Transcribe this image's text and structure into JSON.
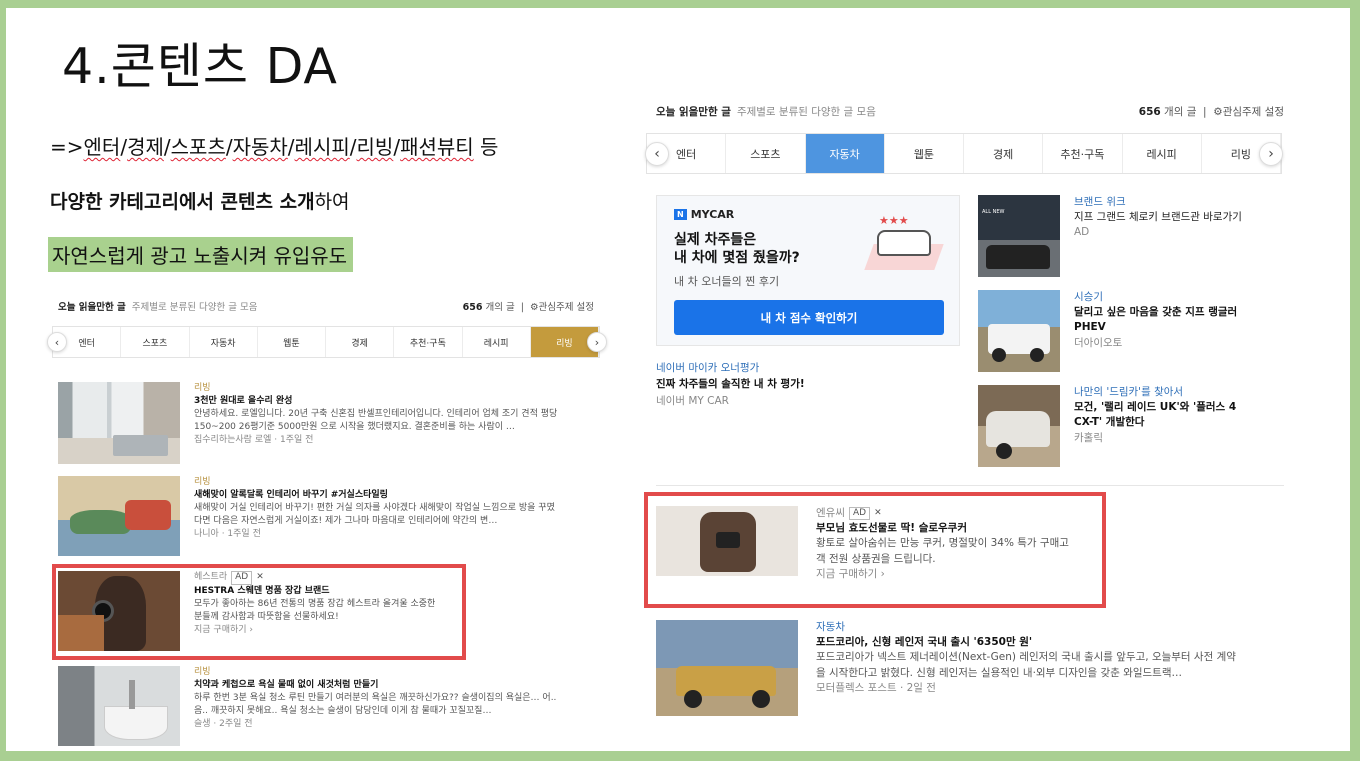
{
  "slide": {
    "title": "4.콘텐츠 DA",
    "line1": {
      "prefix": "=>",
      "cats": [
        "엔터",
        "경제",
        "스포츠",
        "자동차",
        "레시피",
        "리빙",
        "패션뷰티"
      ],
      "suffix": " 등"
    },
    "line2": {
      "bold": "다양한 카테고리에서 콘텐츠 소개",
      "rest": "하여"
    },
    "line3": "자연스럽게 광고 노출시켜 유입유도"
  },
  "left": {
    "header": {
      "title": "오늘 읽을만한 글",
      "subtitle": "주제별로 분류된 다양한 글 모음",
      "count_num": "656",
      "count_unit": " 개의 글",
      "settings": "관심주제 설정"
    },
    "tabs": [
      "엔터",
      "스포츠",
      "자동차",
      "웹툰",
      "경제",
      "추천·구독",
      "레시피",
      "리빙"
    ],
    "active": 7,
    "items": [
      {
        "cat": "리빙",
        "title": "3천만 원대로 올수리 완성",
        "desc": "안녕하세요. 로엘입니다. 20년 구축 신혼집 반셀프인테리어입니다. 인테리어 업체 조기 견적 평당 150~200 26평기준 5000만원 으로 시작을 했더랬지요. 결혼준비를 하는 사람이 …",
        "meta": "집수리하는사람 로엘 · 1주일 전"
      },
      {
        "cat": "리빙",
        "title": "새해맞이 알록달록 인테리어 바꾸기 #거실스타일링",
        "desc": "새해맞이 거실 인테리어 바꾸기! 편한 거실 의자를 사야겠다 새해맞이 작업실 느낌으로 방을 꾸몄다면 다음은 자연스럽게 거실이죠! 제가 그나마 마음대로 인테리어에 약간의 변…",
        "meta": "나니아 · 1주일 전"
      },
      {
        "cat": "헤스트라",
        "ad": "AD",
        "title": "HESTRA 스웨덴 명품 장갑 브랜드",
        "desc": "모두가 좋아하는 86년 전통의 명품 장갑 헤스트라 올겨울 소중한 분들께 감사함과 따뜻함을 선물하세요!",
        "meta": "지금 구매하기 ›"
      },
      {
        "cat": "리빙",
        "title": "치약과 케첩으로 욕실 물때 없이 새것처럼 만들기",
        "desc": "하루 한번 3분 욕실 청소 루틴 만들기 여러분의 욕실은 깨끗하신가요?? 슬생이집의 욕실은… 어.. 음.. 깨끗하지 못해요.. 욕실 청소는 슬생이 담당인데 이게 참 물때가 꼬질꼬질…",
        "meta": "슬생 · 2주일 전"
      }
    ]
  },
  "right": {
    "header": {
      "title": "오늘 읽을만한 글",
      "subtitle": "주제별로 분류된 다양한 글 모음",
      "count_num": "656",
      "count_unit": " 개의 글",
      "settings": "관심주제 설정"
    },
    "tabs": [
      "엔터",
      "스포츠",
      "자동차",
      "웹툰",
      "경제",
      "추천·구독",
      "레시피",
      "리빙"
    ],
    "active": 2,
    "mycar": {
      "logo": "MYCAR",
      "headline1": "실제 차주들은",
      "headline2": "내 차에 몇점 줬을까?",
      "sub": "내 차 오너들의 찐 후기",
      "button": "내 차 점수 확인하기",
      "cat": "네이버 마이카 오너평가",
      "title": "진짜 차주들의 솔직한 내 차 평가!",
      "meta": "네이버 MY CAR"
    },
    "side": [
      {
        "cat": "브랜드 위크",
        "title": "지프 그랜드 체로키 브랜드관 바로가기",
        "meta": "AD"
      },
      {
        "cat": "시승기",
        "title": "달리고 싶은 마음을 갖춘 지프 랭글러 PHEV",
        "meta": "더아이오토"
      },
      {
        "cat": "나만의 '드림카'를 찾아서",
        "title": "모건, '랠리 레이드 UK'와 '플러스 4 CX-T' 개발한다",
        "meta": "카홀릭"
      }
    ],
    "items": [
      {
        "cat": "엔유씨",
        "ad": "AD",
        "title": "부모님 효도선물로 딱! 슬로우쿠커",
        "desc": "황토로 살아숨쉬는 만능 쿠커, 명절맞이 34% 특가 구매고객 전원 상품권을 드립니다.",
        "meta": "지금 구매하기 ›"
      },
      {
        "cat": "자동차",
        "title": "포드코리아, 신형 레인저 국내 출시 '6350만 원'",
        "desc": "포드코리아가 넥스트 제너레이션(Next-Gen) 레인저의 국내 출시를 앞두고, 오늘부터 사전 계약을 시작한다고 밝혔다. 신형 레인저는 실용적인 내·외부 디자인을 갖춘 와일드트랙…",
        "meta": "모터플렉스 포스트 · 2일 전"
      }
    ]
  },
  "colors": {
    "gold": "#c49b3d",
    "blue": "#4e95e0",
    "btn": "#1a73e8",
    "red": "#e24b4b",
    "green": "#a9d18e"
  }
}
